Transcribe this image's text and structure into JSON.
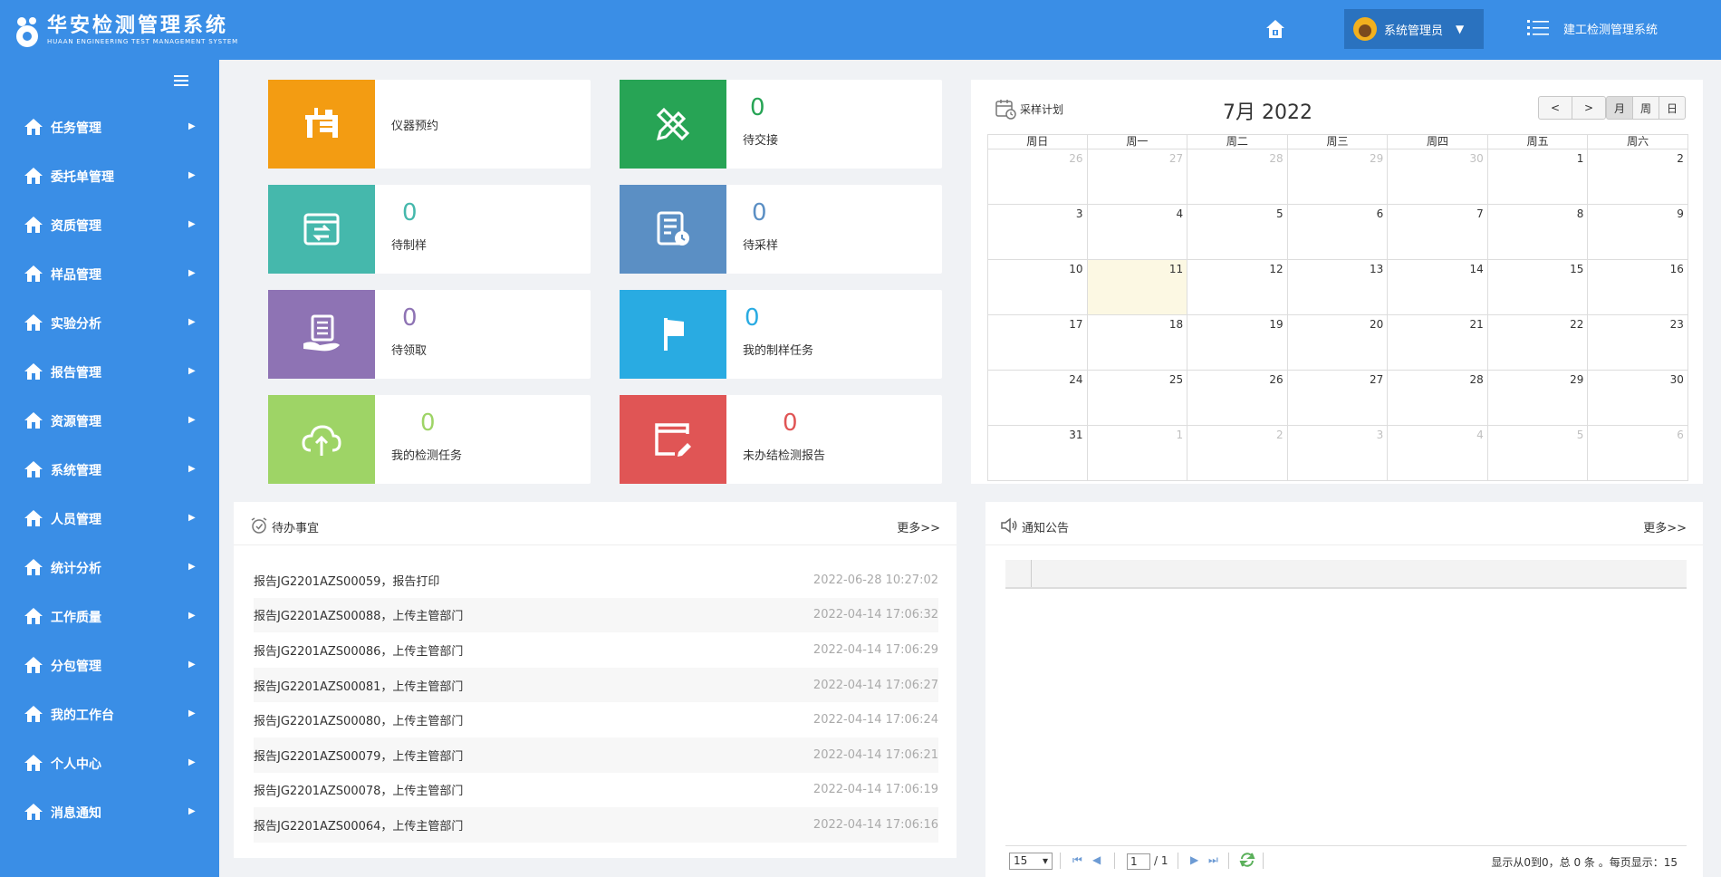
{
  "header": {
    "logo_title": "华安检测管理系统",
    "logo_subtitle": "HUAAN ENGINEERING TEST MANAGEMENT SYSTEM",
    "user_name": "系统管理员",
    "user_caret": "▼",
    "system_name": "建工检测管理系统"
  },
  "sidebar": {
    "items": [
      {
        "label": "任务管理"
      },
      {
        "label": "委托单管理"
      },
      {
        "label": "资质管理"
      },
      {
        "label": "样品管理"
      },
      {
        "label": "实验分析"
      },
      {
        "label": "报告管理"
      },
      {
        "label": "资源管理"
      },
      {
        "label": "系统管理"
      },
      {
        "label": "人员管理"
      },
      {
        "label": "统计分析"
      },
      {
        "label": "工作质量"
      },
      {
        "label": "分包管理"
      },
      {
        "label": "我的工作台"
      },
      {
        "label": "个人中心"
      },
      {
        "label": "消息通知"
      }
    ],
    "arrow": "▶"
  },
  "tiles": [
    {
      "label": "仪器预约",
      "count": "",
      "color": "#f39c12",
      "icon": "desk-icon"
    },
    {
      "label": "待交接",
      "count": "0",
      "color": "#27a455",
      "icon": "pencil-ruler-icon"
    },
    {
      "label": "待制样",
      "count": "0",
      "color": "#45b8ac",
      "icon": "box-exchange-icon"
    },
    {
      "label": "待采样",
      "count": "0",
      "color": "#5b8fc4",
      "icon": "document-clock-icon"
    },
    {
      "label": "待领取",
      "count": "0",
      "color": "#8e73b4",
      "icon": "hand-document-icon"
    },
    {
      "label": "我的制样任务",
      "count": "0",
      "color": "#29abe2",
      "icon": "flag-icon"
    },
    {
      "label": "我的检测任务",
      "count": "0",
      "color": "#9ed466",
      "icon": "cloud-upload-icon"
    },
    {
      "label": "未办结检测报告",
      "count": "0",
      "color": "#e05555",
      "icon": "edit-window-icon"
    }
  ],
  "calendar": {
    "title": "采样计划",
    "month_label": "7月 2022",
    "prev": "<",
    "next": ">",
    "views": [
      "月",
      "周",
      "日"
    ],
    "weekdays": [
      "周日",
      "周一",
      "周二",
      "周三",
      "周四",
      "周五",
      "周六"
    ],
    "weeks": [
      [
        {
          "d": "26",
          "o": true
        },
        {
          "d": "27",
          "o": true
        },
        {
          "d": "28",
          "o": true
        },
        {
          "d": "29",
          "o": true
        },
        {
          "d": "30",
          "o": true
        },
        {
          "d": "1"
        },
        {
          "d": "2"
        }
      ],
      [
        {
          "d": "3"
        },
        {
          "d": "4"
        },
        {
          "d": "5"
        },
        {
          "d": "6"
        },
        {
          "d": "7"
        },
        {
          "d": "8"
        },
        {
          "d": "9"
        }
      ],
      [
        {
          "d": "10"
        },
        {
          "d": "11",
          "t": true
        },
        {
          "d": "12"
        },
        {
          "d": "13"
        },
        {
          "d": "14"
        },
        {
          "d": "15"
        },
        {
          "d": "16"
        }
      ],
      [
        {
          "d": "17"
        },
        {
          "d": "18"
        },
        {
          "d": "19"
        },
        {
          "d": "20"
        },
        {
          "d": "21"
        },
        {
          "d": "22"
        },
        {
          "d": "23"
        }
      ],
      [
        {
          "d": "24"
        },
        {
          "d": "25"
        },
        {
          "d": "26"
        },
        {
          "d": "27"
        },
        {
          "d": "28"
        },
        {
          "d": "29"
        },
        {
          "d": "30"
        }
      ],
      [
        {
          "d": "31"
        },
        {
          "d": "1",
          "o": true
        },
        {
          "d": "2",
          "o": true
        },
        {
          "d": "3",
          "o": true
        },
        {
          "d": "4",
          "o": true
        },
        {
          "d": "5",
          "o": true
        },
        {
          "d": "6",
          "o": true
        }
      ]
    ]
  },
  "todo": {
    "title": "待办事宜",
    "more": "更多>>",
    "items": [
      {
        "text": "报告JG2201AZS00059，报告打印",
        "time": "2022-06-28 10:27:02"
      },
      {
        "text": "报告JG2201AZS00088，上传主管部门",
        "time": "2022-04-14 17:06:32"
      },
      {
        "text": "报告JG2201AZS00086，上传主管部门",
        "time": "2022-04-14 17:06:29"
      },
      {
        "text": "报告JG2201AZS00081，上传主管部门",
        "time": "2022-04-14 17:06:27"
      },
      {
        "text": "报告JG2201AZS00080，上传主管部门",
        "time": "2022-04-14 17:06:24"
      },
      {
        "text": "报告JG2201AZS00079，上传主管部门",
        "time": "2022-04-14 17:06:21"
      },
      {
        "text": "报告JG2201AZS00078，上传主管部门",
        "time": "2022-04-14 17:06:19"
      },
      {
        "text": "报告JG2201AZS00064，上传主管部门",
        "time": "2022-04-14 17:06:16"
      }
    ]
  },
  "notice": {
    "title": "通知公告",
    "more": "更多>>",
    "pager": {
      "page_size": "15",
      "page_input": "1",
      "page_total": "/ 1",
      "info": "显示从0到0，总 0 条 。每页显示：15"
    }
  },
  "colors": {
    "brand": "#3a8ee6",
    "sidebar": "#3a8ee6"
  }
}
